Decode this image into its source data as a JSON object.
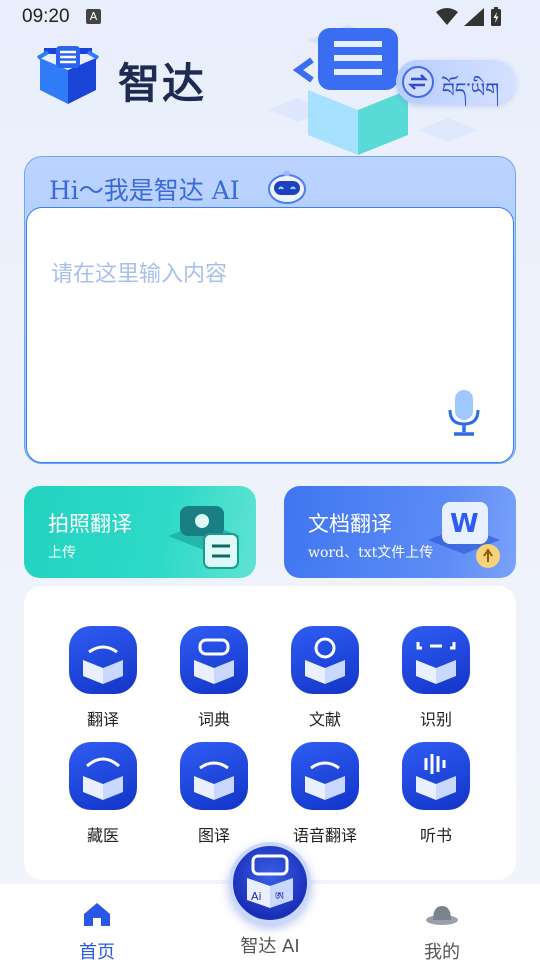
{
  "status_bar": {
    "time": "09:20",
    "notification_letter": "A"
  },
  "header": {
    "app_name": "智达",
    "lang_switch_label": "བོད་ཡིག"
  },
  "input_card": {
    "greeting": "Hi～我是智达 AI",
    "placeholder": "请在这里输入内容"
  },
  "features": [
    {
      "title": "拍照翻译",
      "subtitle": "上传"
    },
    {
      "title": "文档翻译",
      "subtitle": "word、txt文件上传"
    }
  ],
  "grid": [
    {
      "label": "翻译",
      "icon": "translate-icon"
    },
    {
      "label": "词典",
      "icon": "dictionary-icon"
    },
    {
      "label": "文献",
      "icon": "literature-icon"
    },
    {
      "label": "识别",
      "icon": "recognize-icon"
    },
    {
      "label": "藏医",
      "icon": "tibetan-medicine-icon"
    },
    {
      "label": "图译",
      "icon": "image-translate-icon"
    },
    {
      "label": "语音翻译",
      "icon": "voice-translate-icon"
    },
    {
      "label": "听书",
      "icon": "audiobook-icon"
    }
  ],
  "bottom_nav": [
    {
      "label": "首页",
      "active": true
    },
    {
      "label": "智达 AI",
      "active": false
    },
    {
      "label": "我的",
      "active": false
    }
  ],
  "fab_text": {
    "left": "Ai",
    "right": "ཨ"
  },
  "colors": {
    "accent": "#2f5df3",
    "teal": "#22d3c0",
    "nav_active": "#2a58e6",
    "nav_inactive": "#555555"
  }
}
